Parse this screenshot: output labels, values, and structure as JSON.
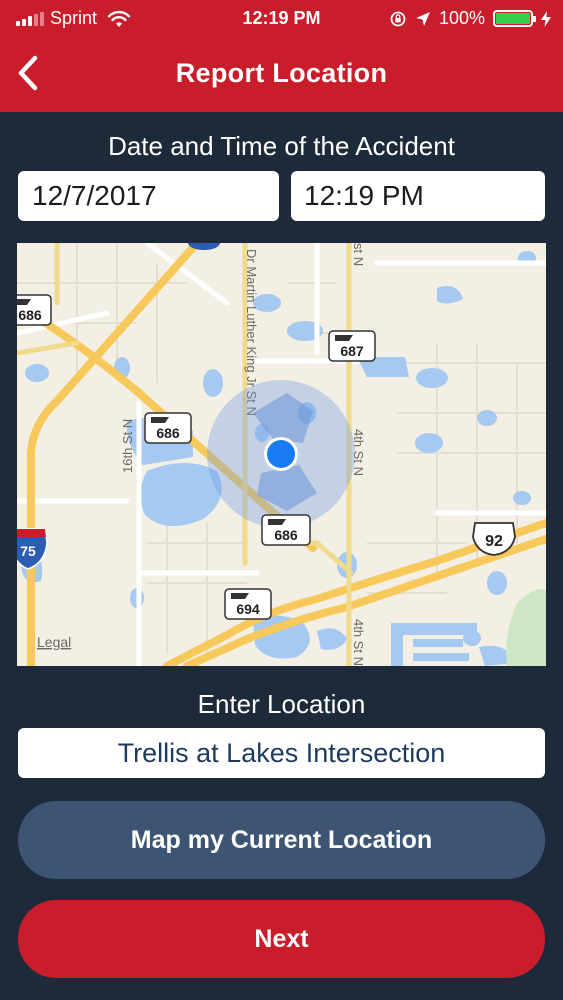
{
  "status_bar": {
    "carrier": "Sprint",
    "time": "12:19 PM",
    "battery": "100%",
    "battery_level": 1.0,
    "icons": [
      "signal-icon",
      "wifi-icon",
      "orientation-lock-icon",
      "location-arrow-icon",
      "battery-icon",
      "charging-bolt-icon"
    ]
  },
  "nav": {
    "back_icon": "chevron-left-icon",
    "title": "Report Location"
  },
  "datetime": {
    "label": "Date and Time of the Accident",
    "date": "12/7/2017",
    "time": "12:19 PM"
  },
  "map": {
    "legal": "Legal",
    "street_labels": [
      "Dr Martin Luther King Jr St N",
      "4th St N",
      "16th St N",
      "4th St N"
    ],
    "shields": [
      "686",
      "687",
      "686",
      "686",
      "694",
      "92",
      "75"
    ],
    "top_street_fragment": "st N"
  },
  "location": {
    "label": "Enter Location",
    "value": "Trellis at Lakes Intersection"
  },
  "buttons": {
    "map_current": "Map my Current Location",
    "next": "Next"
  },
  "colors": {
    "header_red": "#c91d2b",
    "background": "#1c2a3a",
    "secondary_button": "#3d5572",
    "primary_button": "#c91d2b",
    "location_dot": "#1a7cf4"
  }
}
